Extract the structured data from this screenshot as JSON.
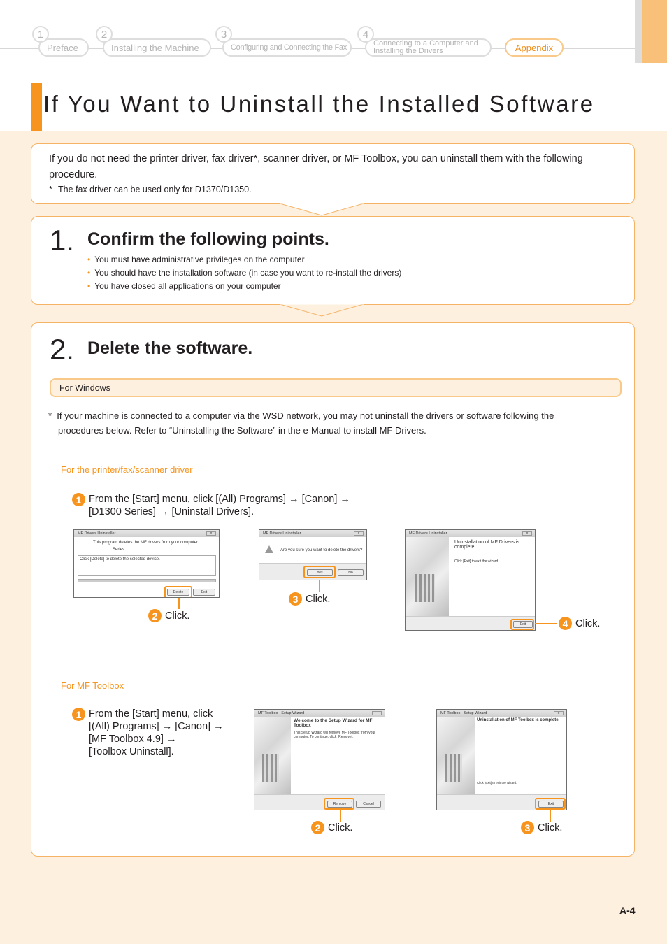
{
  "nav": {
    "items": [
      {
        "num": "1",
        "label": "Preface"
      },
      {
        "num": "2",
        "label": "Installing the Machine"
      },
      {
        "num": "3",
        "label": "Configuring and Connecting the Fax"
      },
      {
        "num": "4",
        "label_line1": "Connecting to a Computer and",
        "label_line2": "Installing the Drivers"
      }
    ],
    "active": "Appendix"
  },
  "page_title": "If You Want to Uninstall the Installed Software",
  "intro": {
    "text": "If you do not need the printer driver, fax driver*, scanner driver, or MF Toolbox, you can uninstall them with the following procedure.",
    "footnote_mark": "*",
    "footnote": "The fax driver can be used only for D1370/D1350."
  },
  "step1": {
    "number": "1.",
    "title": "Confirm the following points.",
    "bullets": [
      "You must have administrative privileges on the computer",
      "You should have the installation software (in case you want to re-install the drivers)",
      "You have closed all applications on your computer"
    ]
  },
  "step2": {
    "number": "2.",
    "title": "Delete the software.",
    "os_bar": "For Windows",
    "note_mark": "*",
    "note": "If your machine is connected to a computer via the WSD network, you may not uninstall the drivers or software following the procedures below. Refer to “Uninstalling the Software” in the e-Manual to install MF Drivers.",
    "driver_section": {
      "heading": "For the printer/fax/scanner driver",
      "instruction_num": "1",
      "instruction_line1": "From the [Start] menu, click [(All) Programs] → [Canon] →",
      "instruction_line2": "[D1300 Series] → [Uninstall Drivers].",
      "dialogs": [
        {
          "title": "MF Drivers Uninstaller",
          "line1": "This program deletes the MF drivers from your computer.",
          "line2": "Series",
          "box_text": "Click [Delete] to delete the selected device.",
          "buttons": [
            "Delete",
            "Exit"
          ],
          "step": "2",
          "click": "Click."
        },
        {
          "title": "MF Drivers Uninstaller",
          "message": "Are you sure you want to delete the drivers?",
          "buttons": [
            "Yes",
            "No"
          ],
          "step": "3",
          "click": "Click."
        },
        {
          "title": "MF Drivers Uninstaller",
          "heading": "Uninstallation of MF Drivers is complete.",
          "message": "Click [Exit] to exit the wizard.",
          "buttons": [
            "Exit"
          ],
          "step": "4",
          "click": "Click."
        }
      ]
    },
    "toolbox_section": {
      "heading": "For MF Toolbox",
      "instruction_num": "1",
      "instruction_lines": [
        "From the [Start] menu, click",
        "[(All) Programs] → [Canon] →",
        "[MF Toolbox 4.9] →",
        "[Toolbox Uninstall]."
      ],
      "dialogs": [
        {
          "title": "MF Toolbox - Setup Wizard",
          "heading": "Welcome to the Setup Wizard for MF Toolbox",
          "message": "This Setup Wizard will remove MF Toolbox from your computer. To continue, click [Remove].",
          "buttons": [
            "Remove",
            "Cancel"
          ],
          "step": "2",
          "click": "Click."
        },
        {
          "title": "MF Toolbox - Setup Wizard",
          "heading": "Uninstallation of MF Toolbox is complete.",
          "message": "Click [Exit] to exit the wizard.",
          "buttons": [
            "Exit"
          ],
          "step": "3",
          "click": "Click."
        }
      ]
    }
  },
  "page_number": "A-4",
  "colors": {
    "accent": "#f7941d",
    "background": "#fdf0df",
    "box_border": "#f5b366"
  }
}
